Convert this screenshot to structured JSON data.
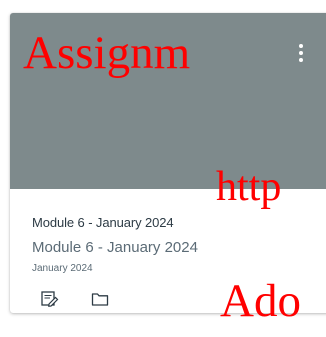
{
  "overlay": {
    "line1": "Assignm",
    "line2": "http",
    "line3": "Ado"
  },
  "card": {
    "title": "Module 6 - January 2024",
    "subtitle": "Module 6 - January 2024",
    "term": "January 2024",
    "hero_color": "#7e8a8c"
  },
  "icons": {
    "options": "more-vertical-icon",
    "assignments": "assignment-edit-icon",
    "files": "folder-icon"
  }
}
